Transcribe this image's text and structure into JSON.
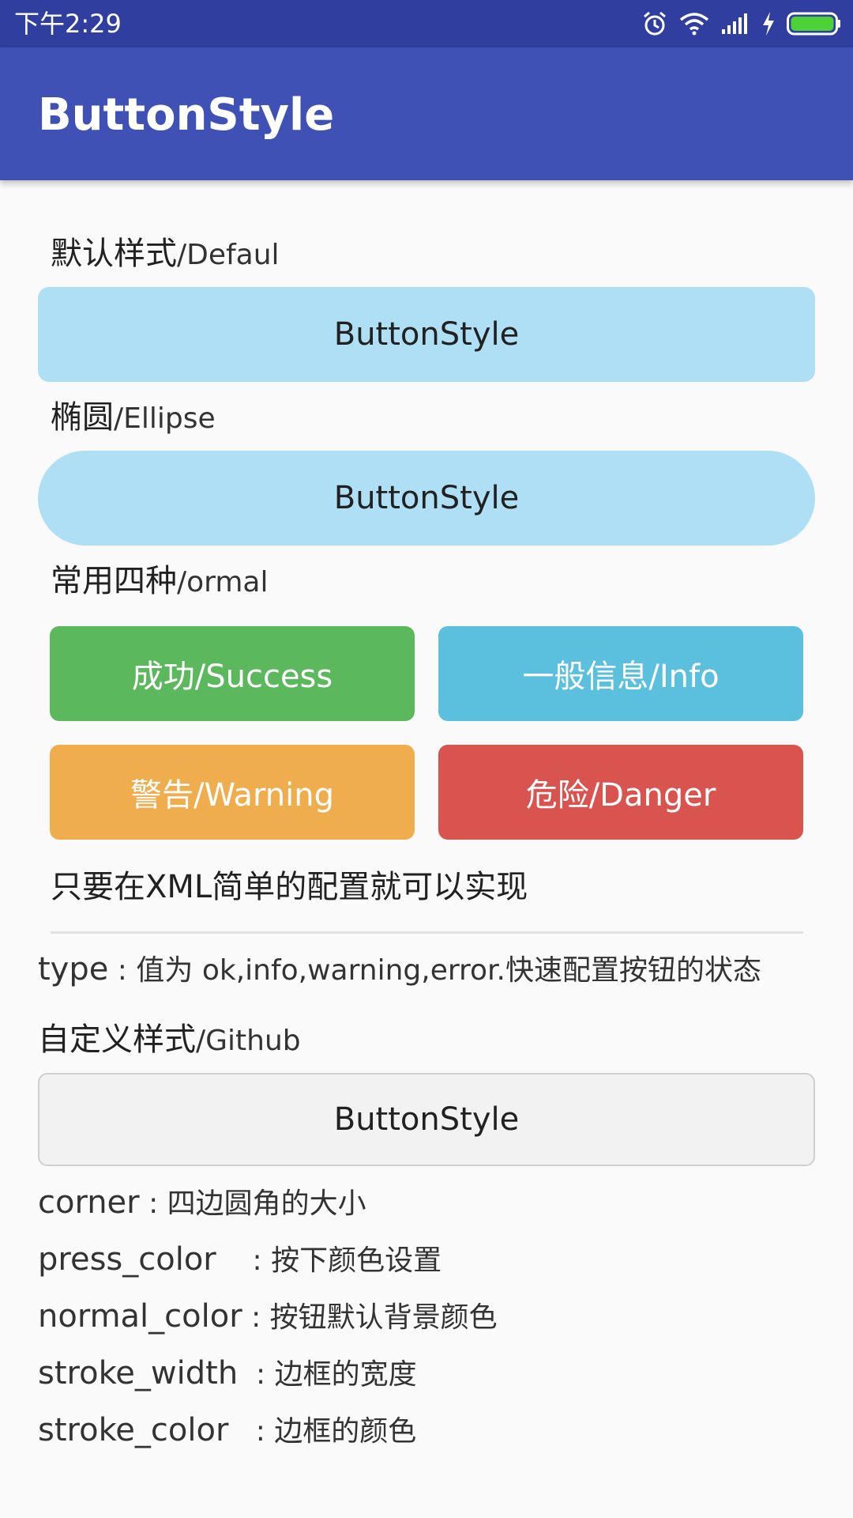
{
  "status_bar": {
    "time": "下午2:29",
    "icons": [
      "alarm-icon",
      "wifi-icon",
      "signal-icon",
      "charging-icon",
      "battery-icon"
    ],
    "battery_color": "#4cd137"
  },
  "app_bar": {
    "title": "ButtonStyle",
    "color": "#3f51b5"
  },
  "sections": {
    "default": {
      "label_cn": "默认样式",
      "label_en": "/Defaul",
      "button": "ButtonStyle"
    },
    "ellipse": {
      "label_cn": "椭圆",
      "label_en": "/Ellipse",
      "button": "ButtonStyle"
    },
    "normal": {
      "label_cn": "常用四种",
      "label_en": "/ormal",
      "buttons": {
        "success": "成功/Success",
        "info": "一般信息/Info",
        "warning": "警告/Warning",
        "danger": "危险/Danger"
      },
      "colors": {
        "success": "#5cb85c",
        "info": "#5bc0de",
        "warning": "#f0ad4e",
        "danger": "#d9534f"
      }
    },
    "note": "只要在XML简单的配置就可以实现",
    "type_line": {
      "key": "type",
      "desc": " : 值为 ok,info,warning,error.快速配置按钮的状态"
    },
    "custom": {
      "label_cn": "自定义样式",
      "label_en": "/Github",
      "button": "ButtonStyle"
    },
    "properties": [
      {
        "key": "corner",
        "desc": " : 四边圆角的大小"
      },
      {
        "key": "press_color",
        "desc": "    : 按下颜色设置"
      },
      {
        "key": "normal_color",
        "desc": " : 按钮默认背景颜色"
      },
      {
        "key": "stroke_width",
        "desc": "  : 边框的宽度"
      },
      {
        "key": "stroke_color",
        "desc": "   : 边框的颜色"
      }
    ]
  }
}
